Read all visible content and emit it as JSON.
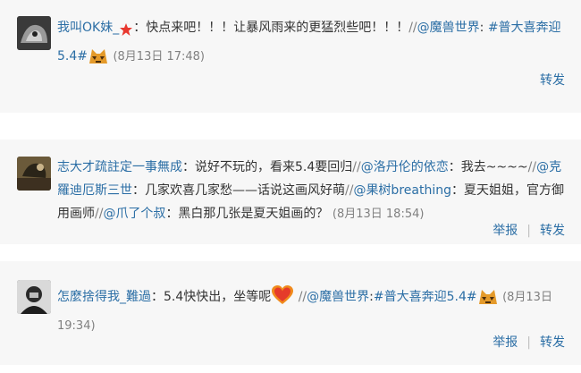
{
  "posts": [
    {
      "user": "我叫OK妹_",
      "text1": "：快点来吧！！！让暴风雨来的更猛烈些吧！！！",
      "slash1": "//",
      "mention1": "@魔兽世界",
      "colon1": ": ",
      "hashtag": "#普大喜奔迎5.4#",
      "time": "(8月13日 17:48)",
      "actions": {
        "forward": "转发"
      }
    },
    {
      "user": "志大才疏註定一事無成",
      "text1": "：说好不玩的，看来5.4要回归",
      "slash1": "//",
      "mention1": "@洛丹伦的依恋",
      "text2": "：我去~~~~",
      "slash2": "//",
      "mention2": "@克羅迪厄斯三世",
      "text3": "：几家欢喜几家愁——话说这画风好萌",
      "slash3": "//",
      "mention3": "@果树breathing",
      "text4": "：夏天姐姐，官方御用画师",
      "slash4": "//",
      "mention4": "@爪了个叔",
      "text5": "：黑白那几张是夏天姐画的？",
      "time": "(8月13日 18:54)",
      "actions": {
        "report": "举报",
        "forward": "转发"
      }
    },
    {
      "user": "怎麼捨得我_難過",
      "text1": "：5.4快快出，坐等呢",
      "slash1": "//",
      "mention1": "@魔兽世界",
      "colon1": ":",
      "hashtag": "#普大喜奔迎5.4#",
      "time": "(8月13日 19:34)",
      "actions": {
        "report": "举报",
        "forward": "转发"
      }
    }
  ],
  "colors": {
    "link": "#2b6ea5",
    "text": "#333333",
    "meta": "#808080",
    "card": "#f7f7f7"
  }
}
